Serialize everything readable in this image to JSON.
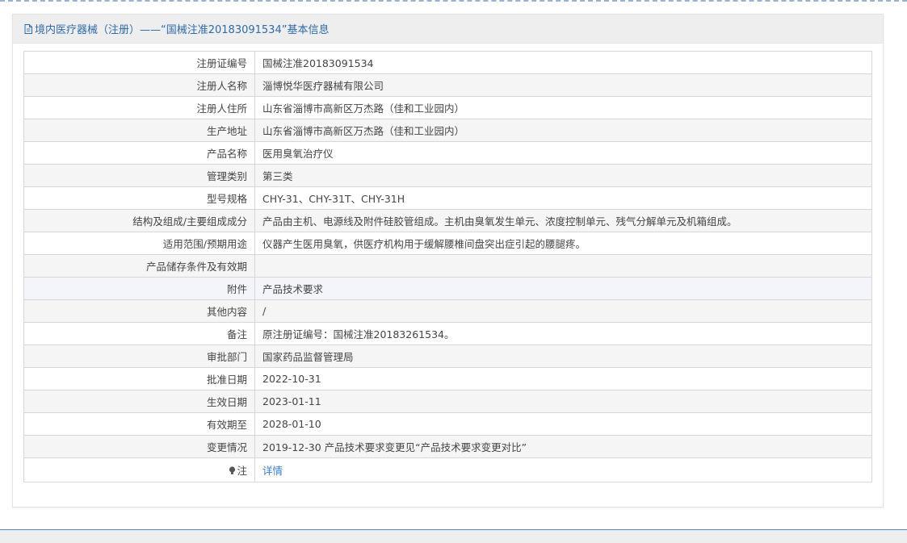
{
  "header": {
    "title": "境内医疗器械（注册）——“国械注准20183091534”基本信息"
  },
  "rows": [
    {
      "label": "注册证编号",
      "value": "国械注准20183091534"
    },
    {
      "label": "注册人名称",
      "value": "淄博悦华医疗器械有限公司"
    },
    {
      "label": "注册人住所",
      "value": "山东省淄博市高新区万杰路（佳和工业园内）"
    },
    {
      "label": "生产地址",
      "value": "山东省淄博市高新区万杰路（佳和工业园内）"
    },
    {
      "label": "产品名称",
      "value": "医用臭氧治疗仪"
    },
    {
      "label": "管理类别",
      "value": "第三类"
    },
    {
      "label": "型号规格",
      "value": "CHY-31、CHY-31T、CHY-31H"
    },
    {
      "label": "结构及组成/主要组成成分",
      "value": "产品由主机、电源线及附件硅胶管组成。主机由臭氧发生单元、浓度控制单元、残气分解单元及机箱组成。"
    },
    {
      "label": "适用范围/预期用途",
      "value": "仪器产生医用臭氧，供医疗机构用于缓解腰椎间盘突出症引起的腰腿疼。"
    },
    {
      "label": "产品储存条件及有效期",
      "value": ""
    },
    {
      "label": "附件",
      "value": "产品技术要求"
    },
    {
      "label": "其他内容",
      "value": "/"
    },
    {
      "label": "备注",
      "value": "原注册证编号：国械注准20183261534。"
    },
    {
      "label": "审批部门",
      "value": "国家药品监督管理局"
    },
    {
      "label": "批准日期",
      "value": "2022-10-31"
    },
    {
      "label": "生效日期",
      "value": "2023-01-11"
    },
    {
      "label": "有效期至",
      "value": "2028-01-10"
    },
    {
      "label": "变更情况",
      "value": "2019-12-30 产品技术要求变更见“产品技术要求变更对比”"
    }
  ],
  "note": {
    "label": "注",
    "icon": "bulb-icon",
    "link_text": "详情"
  },
  "colors": {
    "header_text": "#2f6aa8",
    "link": "#3a7bc8",
    "border": "#d7d7d7",
    "row_alt": "#f5f5f5"
  }
}
